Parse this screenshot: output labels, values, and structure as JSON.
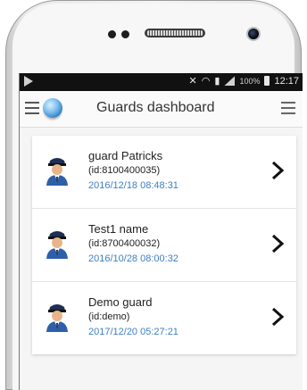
{
  "status": {
    "battery_percent": "100%",
    "time": "12:17"
  },
  "header": {
    "title": "Guards dashboard",
    "menu_icon": "hamburger-menu-icon",
    "logo_icon": "globe-icon",
    "overflow_icon": "hamburger-menu-icon"
  },
  "guards": [
    {
      "name": "guard Patricks",
      "id": "(id:8100400035)",
      "timestamp": "2016/12/18 08:48:31"
    },
    {
      "name": "Test1 name",
      "id": "(id:8700400032)",
      "timestamp": "2016/10/28 08:00:32"
    },
    {
      "name": "Demo guard",
      "id": "(id:demo)",
      "timestamp": "2017/12/20 05:27:21"
    }
  ],
  "colors": {
    "timestamp": "#3f7fc0",
    "status_bar": "#111111",
    "avatar_uniform": "#2f5fa8"
  }
}
